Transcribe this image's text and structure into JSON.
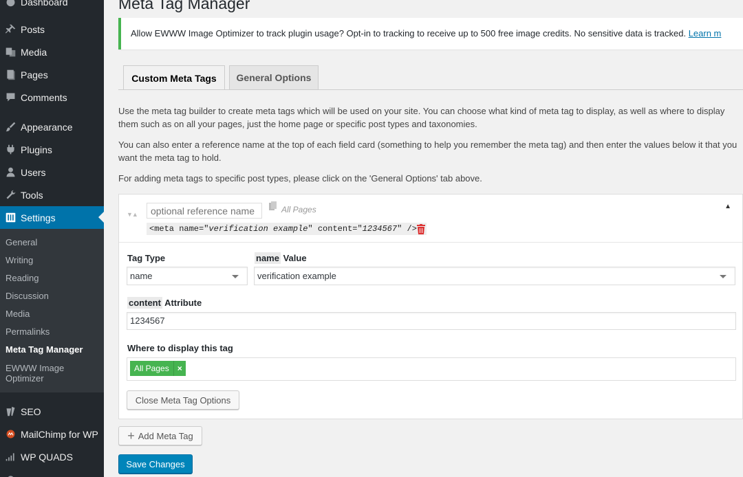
{
  "page_title": "Meta Tag Manager",
  "notice": {
    "text": "Allow EWWW Image Optimizer to track plugin usage? Opt-in to tracking to receive up to 500 free image credits. No sensitive data is tracked. ",
    "link": "Learn m",
    "accent_color": "#46b450"
  },
  "sidebar": {
    "top_partial": "Dashboard",
    "items": [
      {
        "label": "Posts",
        "icon": "pushpin-icon"
      },
      {
        "label": "Media",
        "icon": "media-icon"
      },
      {
        "label": "Pages",
        "icon": "pages-icon"
      },
      {
        "label": "Comments",
        "icon": "comments-icon"
      },
      {
        "label": "Appearance",
        "icon": "paintbrush-icon"
      },
      {
        "label": "Plugins",
        "icon": "plugin-icon"
      },
      {
        "label": "Users",
        "icon": "users-icon"
      },
      {
        "label": "Tools",
        "icon": "wrench-icon"
      },
      {
        "label": "Settings",
        "icon": "settings-icon"
      }
    ],
    "submenu": [
      "General",
      "Writing",
      "Reading",
      "Discussion",
      "Media",
      "Permalinks",
      "Meta Tag Manager",
      "EWWW Image",
      "Optimizer"
    ],
    "bottom_items": [
      {
        "label": "SEO",
        "icon": "seo-icon"
      },
      {
        "label": "MailChimp for WP",
        "icon": "mailchimp-icon"
      },
      {
        "label": "WP QUADS",
        "icon": "signal-icon"
      }
    ],
    "active_color": "#0073aa"
  },
  "tabs": [
    "Custom Meta Tags",
    "General Options"
  ],
  "descriptions": [
    "Use the meta tag builder to create meta tags which will be used on your site. You can choose what kind of meta tag to display, as well as where to display them such as on all your pages, just the home page or specific post types and taxonomies.",
    "You can also enter a reference name at the top of each field card (something to help you remember the meta tag) and then enter the values below it that you want the meta tag to hold.",
    "For adding meta tags to specific post types, please click on the 'General Options' tab above."
  ],
  "card": {
    "reference_placeholder": "optional reference name",
    "scope": "All Pages",
    "preview": {
      "open": "<meta name=\"",
      "name_value": "verification example",
      "middle": "\" content=\"",
      "content_value": "1234567",
      "close": "\" />"
    },
    "tag_type_label": "Tag Type",
    "tag_type_value": "name",
    "value_code": "name",
    "value_label": " Value",
    "value_value": "verification example",
    "content_code": "content",
    "content_label": " Attribute",
    "content_value": "1234567",
    "display_label": "Where to display this tag",
    "display_token": "All Pages",
    "token_remove": "×",
    "token_color": "#46b450",
    "close_button": "Close Meta Tag Options"
  },
  "add_button": "Add Meta Tag",
  "save_button": "Save Changes"
}
